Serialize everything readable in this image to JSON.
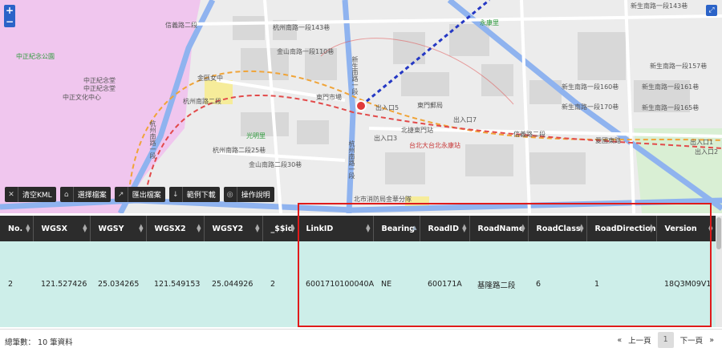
{
  "map": {
    "zoom_in": "+",
    "zoom_out": "−",
    "labels": [
      {
        "text": "中正紀念公園",
        "cls": "green"
      },
      {
        "text": "中正紀念堂",
        "cls": ""
      },
      {
        "text": "中正紀念堂",
        "cls": ""
      },
      {
        "text": "中正文化中心",
        "cls": ""
      },
      {
        "text": "杭州南路一段143巷",
        "cls": ""
      },
      {
        "text": "金山南路一段110巷",
        "cls": ""
      },
      {
        "text": "信義路二段",
        "cls": ""
      },
      {
        "text": "杭州南路二段",
        "cls": ""
      },
      {
        "text": "杭州南路二段25巷",
        "cls": ""
      },
      {
        "text": "金山南路二段30巷",
        "cls": ""
      },
      {
        "text": "光明里",
        "cls": "green"
      },
      {
        "text": "金甌女中",
        "cls": ""
      },
      {
        "text": "東門市場",
        "cls": ""
      },
      {
        "text": "東門郵局",
        "cls": ""
      },
      {
        "text": "出入口5",
        "cls": ""
      },
      {
        "text": "出入口7",
        "cls": ""
      },
      {
        "text": "出入口3",
        "cls": ""
      },
      {
        "text": "台北大台北永康站",
        "cls": "red"
      },
      {
        "text": "北捷東門站",
        "cls": ""
      },
      {
        "text": "新生南路一段143巷",
        "cls": ""
      },
      {
        "text": "新生南路一段157巷",
        "cls": ""
      },
      {
        "text": "新生南路一段160巷",
        "cls": ""
      },
      {
        "text": "新生南路一段161巷",
        "cls": ""
      },
      {
        "text": "新生南路一段165巷",
        "cls": ""
      },
      {
        "text": "新生南路一段170巷",
        "cls": ""
      },
      {
        "text": "信義路二段",
        "cls": ""
      },
      {
        "text": "永康里",
        "cls": "green"
      },
      {
        "text": "出入口1",
        "cls": ""
      },
      {
        "text": "出入口2",
        "cls": ""
      },
      {
        "text": "北市消防局金華分隊",
        "cls": ""
      },
      {
        "text": "杭州南路一段",
        "cls": ""
      },
      {
        "text": "新生南路一段",
        "cls": ""
      },
      {
        "text": "愛國東路",
        "cls": ""
      },
      {
        "text": "杭州南路一段",
        "cls": ""
      }
    ]
  },
  "toolbar": [
    {
      "label": "清空KML",
      "icon": "✕",
      "name": "clear-kml-button",
      "iconname": "close-icon"
    },
    {
      "label": "選擇檔案",
      "icon": "⌂",
      "name": "choose-file-button",
      "iconname": "folder-icon"
    },
    {
      "label": "匯出檔案",
      "icon": "↗",
      "name": "export-file-button",
      "iconname": "export-icon"
    },
    {
      "label": "範例下載",
      "icon": "↓",
      "name": "sample-download-button",
      "iconname": "download-icon"
    },
    {
      "label": "操作說明",
      "icon": "◎",
      "name": "instructions-button",
      "iconname": "help-icon"
    }
  ],
  "table": {
    "columns": [
      "No.",
      "WGSX",
      "WGSY",
      "WGSX2",
      "WGSY2",
      "_$$id",
      "LinkID",
      "Bearing",
      "RoadID",
      "RoadName",
      "RoadClass",
      "RoadDirection",
      "Version"
    ],
    "rows": [
      [
        "2",
        "121.527426",
        "25.034265",
        "121.549153",
        "25.044926",
        "2",
        "6001710100040A",
        "NE",
        "600171A",
        "基隆路二段",
        "6",
        "1",
        "18Q3M09V1"
      ]
    ]
  },
  "footer": {
    "total": "總筆數： 10 筆資料",
    "first": "«",
    "prev": "上一頁",
    "page": "1",
    "next": "下一頁",
    "last": "»"
  },
  "colors": {
    "highlight": "#e01b1b",
    "row": "#cdeee9",
    "header": "#2c2c2c",
    "road": "#7fa8e8"
  }
}
